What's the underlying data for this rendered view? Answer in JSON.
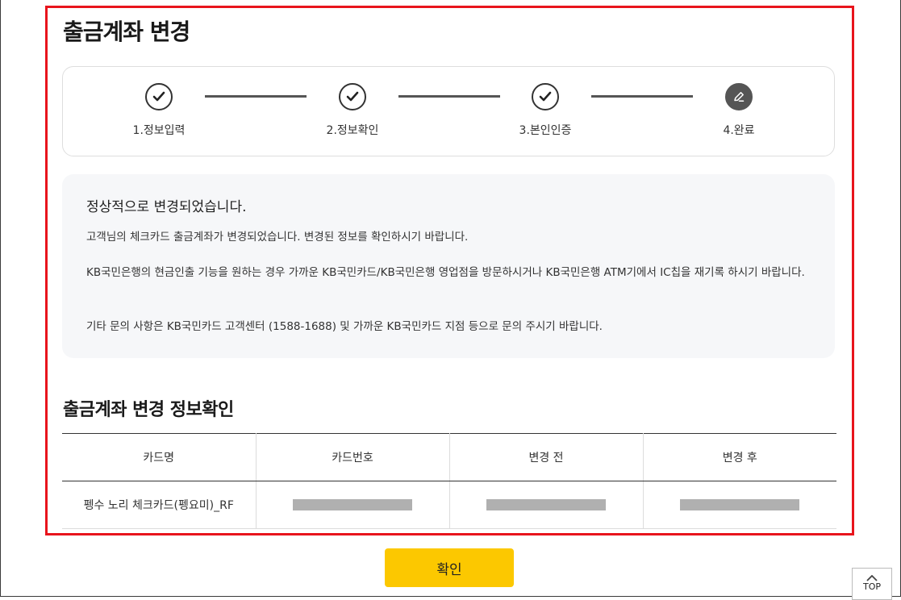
{
  "page_title": "출금계좌 변경",
  "steps": [
    {
      "label": "1.정보입력",
      "status": "done"
    },
    {
      "label": "2.정보확인",
      "status": "done"
    },
    {
      "label": "3.본인인증",
      "status": "done"
    },
    {
      "label": "4.완료",
      "status": "current"
    }
  ],
  "notice": {
    "title": "정상적으로 변경되었습니다.",
    "line1": "고객님의 체크카드 출금계좌가 변경되었습니다. 변경된 정보를 확인하시기 바랍니다.",
    "line2": "KB국민은행의 현금인출 기능을 원하는 경우 가까운 KB국민카드/KB국민은행 영업점을 방문하시거나 KB국민은행 ATM기에서 IC칩을 재기록 하시기 바랍니다.",
    "line3": "기타 문의 사항은 KB국민카드 고객센터 (1588-1688) 및 가까운 KB국민카드 지점 등으로 문의 주시기 바랍니다."
  },
  "section_title": "출금계좌 변경 정보확인",
  "table": {
    "headers": [
      "카드명",
      "카드번호",
      "변경 전",
      "변경 후"
    ],
    "row": {
      "card_name": "펭수 노리 체크카드(펭요미)_RF"
    }
  },
  "confirm_label": "확인",
  "top_label": "TOP",
  "colors": {
    "accent": "#fcc800",
    "highlight": "#e8141c",
    "step": "#555555"
  }
}
